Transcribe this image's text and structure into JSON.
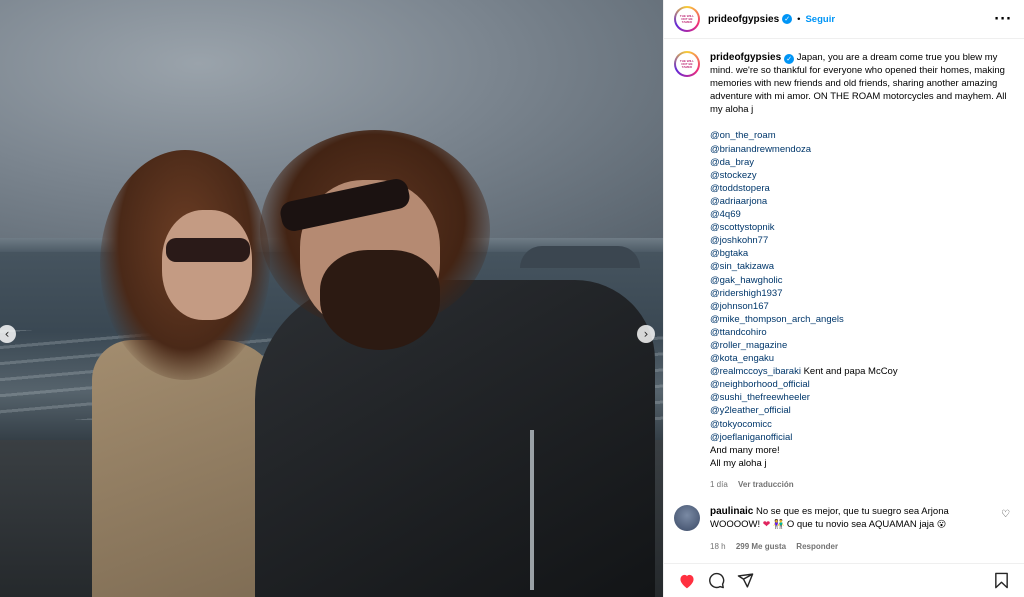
{
  "post": {
    "username": "prideofgypsies",
    "follow_label": "Seguir",
    "avatar_text": "THE WILL NOT BE TAMED"
  },
  "caption": {
    "text": "Japan, you are a dream come true you blew my mind. we're so thankful for everyone who opened their homes, making memories with new friends and old friends, sharing another amazing adventure with mi amor. ON THE ROAM motorcycles and mayhem. All my aloha j",
    "handles": [
      "@on_the_roam",
      "@brianandrewmendoza",
      "@da_bray",
      "@stockezy",
      "@toddstopera",
      "@adriaarjona",
      "@4q69",
      "@scottystopnik",
      "@joshkohn77",
      "@bgtaka",
      "@sin_takizawa",
      "@gak_hawgholic",
      "@ridershigh1937",
      "@johnson167",
      "@mike_thompson_arch_angels",
      "@ttandcohiro",
      "@roller_magazine",
      "@kota_engaku"
    ],
    "handle_with_note": "@realmccoys_ibaraki",
    "handle_note": " Kent and papa McCoy",
    "handles_after": [
      "@neighborhood_official",
      "@sushi_thefreewheeler",
      "@y2leather_official",
      "@tokyocomicc",
      "@joeflaniganofficial"
    ],
    "closing_1": "And many more!",
    "closing_2": "All my aloha j",
    "time": "1 día",
    "translate": "Ver traducción"
  },
  "comment": {
    "username": "paulinaic",
    "text_1": "No se que es mejor, que tu suegro sea Arjona WOOOOW!",
    "text_2": "O que tu novio sea AQUAMAN jaja",
    "time": "18 h",
    "likes": "299 Me gusta",
    "reply": "Responder"
  },
  "colors": {
    "link": "#00376b",
    "follow": "#0095f6",
    "like_red": "#ff3040"
  },
  "icons": [
    "verified-icon",
    "more-options-icon",
    "carousel-prev-icon",
    "carousel-next-icon",
    "like-heart-icon",
    "comment-icon",
    "share-icon",
    "save-bookmark-icon",
    "comment-like-icon"
  ]
}
